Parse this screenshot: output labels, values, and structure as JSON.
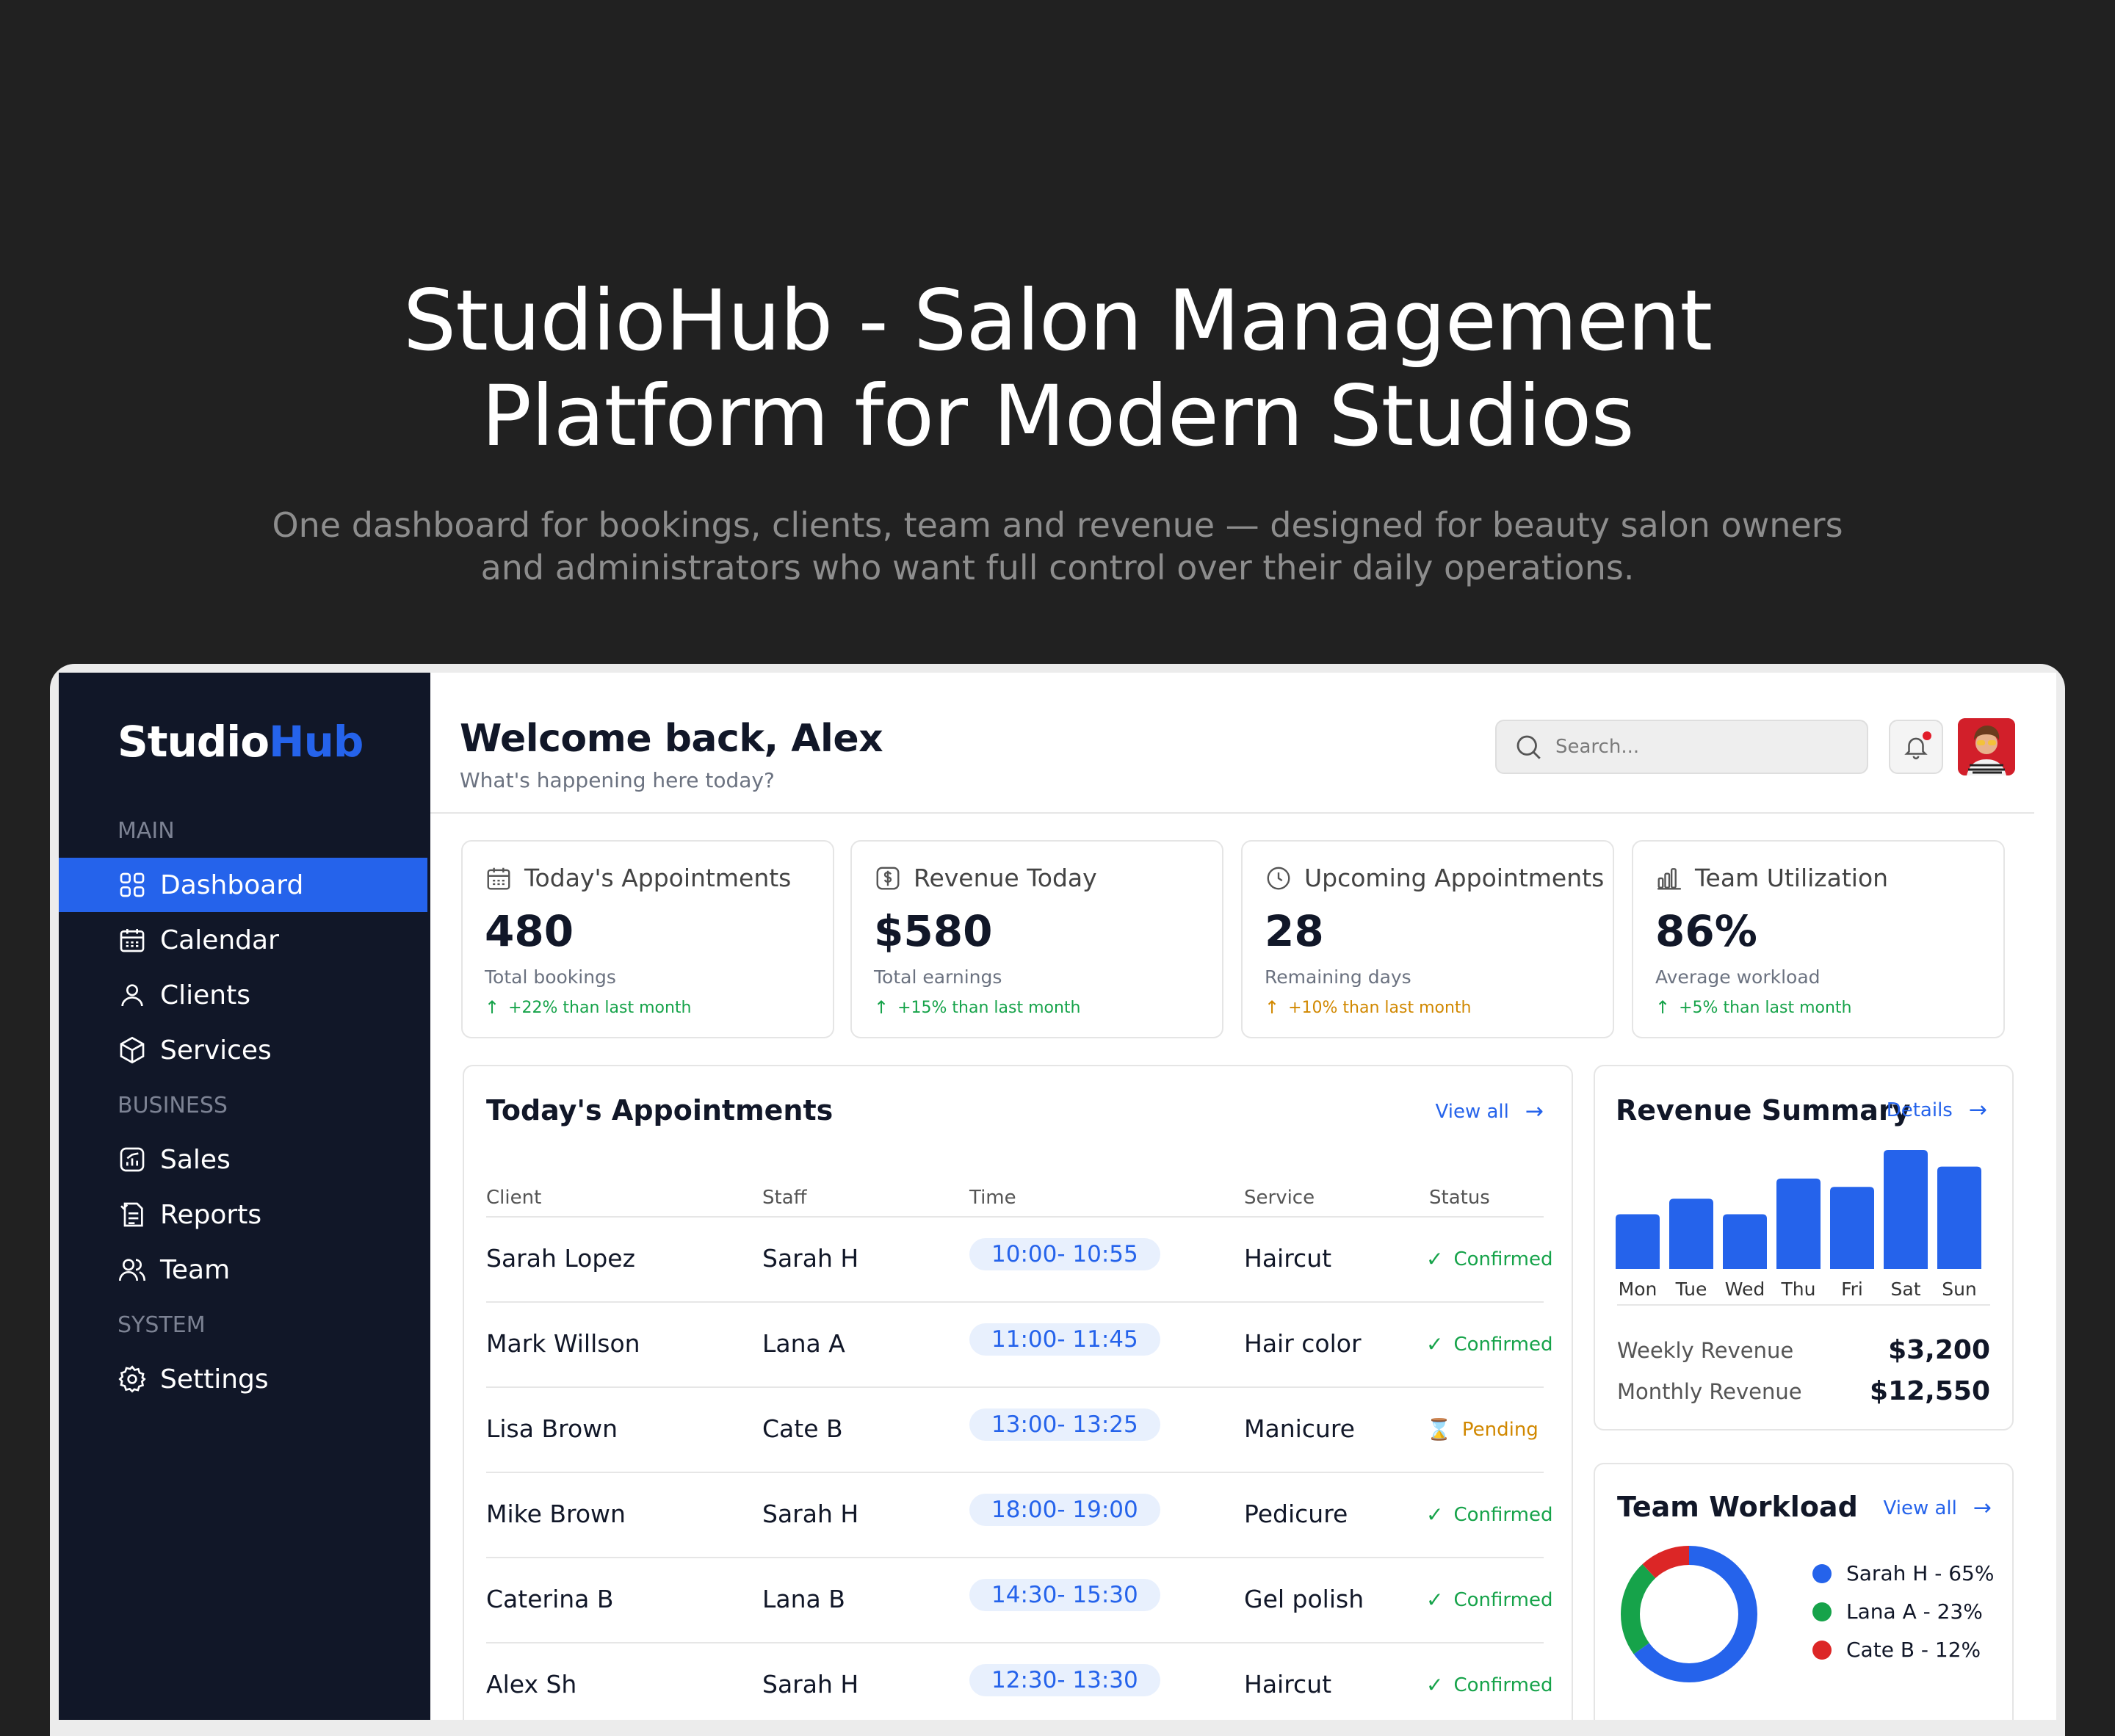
{
  "hero": {
    "title_line1": "StudioHub - Salon Management",
    "title_line2": "Platform for Modern Studios",
    "subtitle_line1": "One dashboard for bookings, clients, team and revenue — designed for beauty salon owners",
    "subtitle_line2": "and administrators who want full control over their daily operations."
  },
  "sidebar": {
    "logo_part1": "Studio",
    "logo_part2": "Hub",
    "sections": {
      "main": "MAIN",
      "business": "BUSINESS",
      "system": "SYSTEM"
    },
    "items": [
      {
        "label": "Dashboard",
        "icon": "grid-icon",
        "active": true
      },
      {
        "label": "Calendar",
        "icon": "calendar-icon"
      },
      {
        "label": "Clients",
        "icon": "user-icon"
      },
      {
        "label": "Services",
        "icon": "box-icon"
      },
      {
        "label": "Sales",
        "icon": "chart-icon"
      },
      {
        "label": "Reports",
        "icon": "report-icon"
      },
      {
        "label": "Team",
        "icon": "team-icon"
      },
      {
        "label": "Settings",
        "icon": "gear-icon"
      }
    ]
  },
  "header": {
    "welcome": "Welcome back, Alex",
    "subtitle": "What's happening here today?",
    "search_placeholder": "Search..."
  },
  "stats": [
    {
      "title": "Today's Appointments",
      "icon": "calendar-icon",
      "value": "480",
      "label": "Total bookings",
      "delta": "+22% than last month",
      "delta_color": "#16a34a"
    },
    {
      "title": "Revenue Today",
      "icon": "dollar-icon",
      "value": "$580",
      "label": "Total earnings",
      "delta": "+15% than last month",
      "delta_color": "#16a34a"
    },
    {
      "title": "Upcoming Appointments",
      "icon": "clock-icon",
      "value": "28",
      "label": "Remaining days",
      "delta": "+10% than last month",
      "delta_color": "#d18800"
    },
    {
      "title": "Team Utilization",
      "icon": "bars-icon",
      "value": "86%",
      "label": "Average workload",
      "delta": "+5% than last month",
      "delta_color": "#16a34a"
    }
  ],
  "appointments": {
    "title": "Today's Appointments",
    "view_all": "View all",
    "columns": [
      "Client",
      "Staff",
      "Time",
      "Service",
      "Status"
    ],
    "rows": [
      {
        "client": "Sarah Lopez",
        "staff": "Sarah H",
        "time": "10:00- 10:55",
        "service": "Haircut",
        "status": "Confirmed"
      },
      {
        "client": "Mark Willson",
        "staff": "Lana A",
        "time": "11:00- 11:45",
        "service": "Hair color",
        "status": "Confirmed"
      },
      {
        "client": "Lisa Brown",
        "staff": "Cate B",
        "time": "13:00- 13:25",
        "service": "Manicure",
        "status": "Pending"
      },
      {
        "client": "Mike Brown",
        "staff": "Sarah H",
        "time": "18:00- 19:00",
        "service": "Pedicure",
        "status": "Confirmed"
      },
      {
        "client": "Caterina B",
        "staff": "Lana B",
        "time": "14:30- 15:30",
        "service": "Gel polish",
        "status": "Confirmed"
      },
      {
        "client": "Alex Sh",
        "staff": "Sarah H",
        "time": "12:30- 13:30",
        "service": "Haircut",
        "status": "Confirmed"
      }
    ]
  },
  "revenue": {
    "title": "Revenue Summary",
    "details": "Details",
    "weekly_label": "Weekly Revenue",
    "weekly_value": "$3,200",
    "monthly_label": "Monthly Revenue",
    "monthly_value": "$12,550"
  },
  "workload": {
    "title": "Team Workload",
    "view_all": "View all",
    "legend": [
      {
        "label": "Sarah H - 65%",
        "color": "#2563eb"
      },
      {
        "label": "Lana A - 23%",
        "color": "#16a34a"
      },
      {
        "label": "Cate B - 12%",
        "color": "#dc2626"
      }
    ]
  },
  "chart_data": [
    {
      "type": "bar",
      "categories": [
        "Mon",
        "Tue",
        "Wed",
        "Thu",
        "Fri",
        "Sat",
        "Sun"
      ],
      "values": [
        0.46,
        0.59,
        0.46,
        0.76,
        0.69,
        1.0,
        0.86
      ],
      "color": "#2563eb",
      "grid": false,
      "legend": false
    },
    {
      "type": "pie",
      "donut": true,
      "categories": [
        "Sarah H",
        "Lana A",
        "Cate B"
      ],
      "values": [
        65,
        23,
        12
      ],
      "colors": [
        "#2563eb",
        "#16a34a",
        "#dc2626"
      ]
    }
  ]
}
